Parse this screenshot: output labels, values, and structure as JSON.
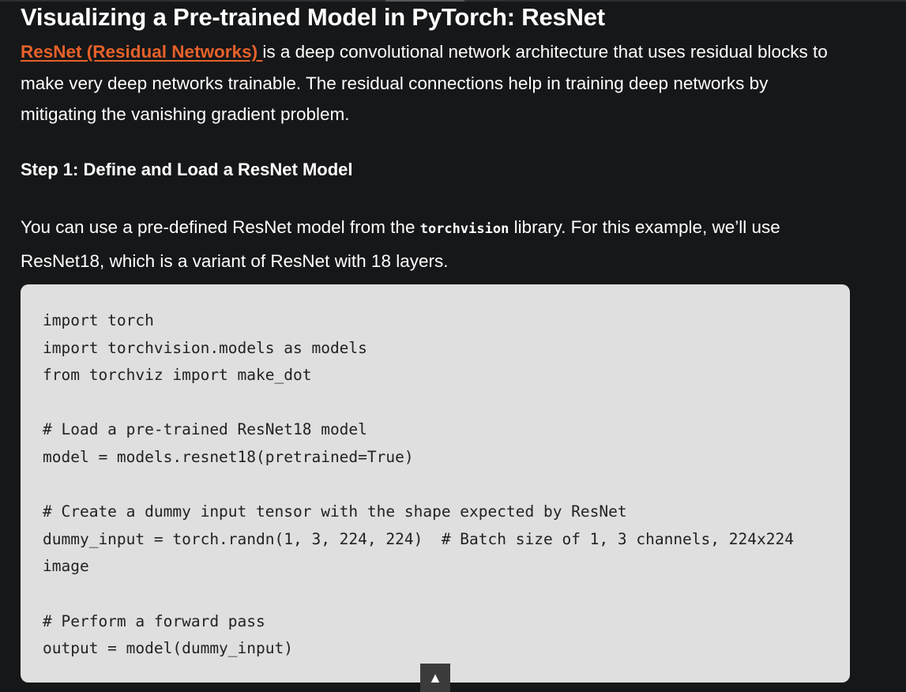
{
  "article": {
    "title": "Visualizing a Pre-trained Model in PyTorch: ResNet",
    "intro_link": "ResNet (Residual Networks) ",
    "intro_text": "is a deep convolutional network architecture that uses residual blocks to make very deep networks trainable. The residual connections help in training deep networks by mitigating the vanishing gradient problem.",
    "step_heading": "Step 1: Define and Load a ResNet Model",
    "para_before_code": "You can use a pre-defined ResNet model from the ",
    "inline_code": "torchvision",
    "para_after_code": " library. For this example, we’ll use ResNet18, which is a variant of ResNet with 18 layers.",
    "accent_color": "#e6612a"
  },
  "code": {
    "lines": [
      "import torch",
      "import torchvision.models as models",
      "from torchviz import make_dot",
      "",
      "# Load a pre-trained ResNet18 model",
      "model = models.resnet18(pretrained=True)",
      "",
      "# Create a dummy input tensor with the shape expected by ResNet",
      "dummy_input = torch.randn(1, 3, 224, 224)  # Batch size of 1, 3 channels, 224x224",
      "image",
      "",
      "# Perform a forward pass",
      "output = model(dummy_input)"
    ]
  },
  "scroll_top": {
    "icon": "▲",
    "icon_name": "arrow-up-icon"
  }
}
